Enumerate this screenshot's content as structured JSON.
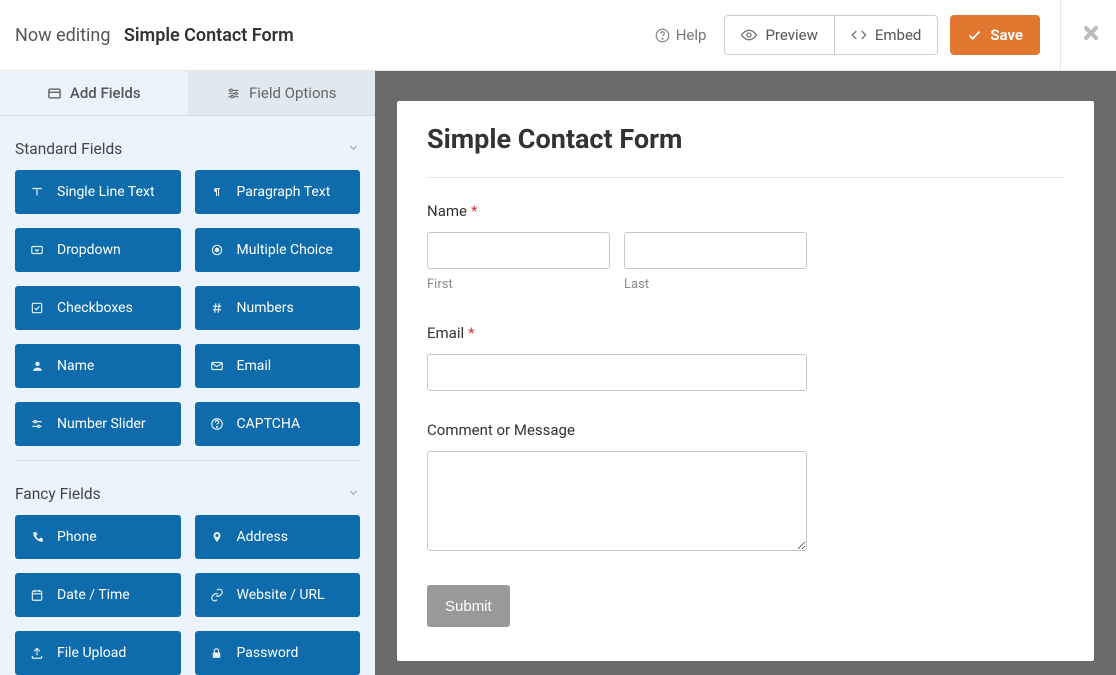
{
  "header": {
    "now_editing": "Now editing",
    "form_name": "Simple Contact Form",
    "help": "Help",
    "preview": "Preview",
    "embed": "Embed",
    "save": "Save"
  },
  "sidebar": {
    "tab_add_fields": "Add Fields",
    "tab_field_options": "Field Options",
    "section_standard": "Standard Fields",
    "section_fancy": "Fancy Fields",
    "standard_fields": {
      "single_line_text": "Single Line Text",
      "paragraph_text": "Paragraph Text",
      "dropdown": "Dropdown",
      "multiple_choice": "Multiple Choice",
      "checkboxes": "Checkboxes",
      "numbers": "Numbers",
      "name": "Name",
      "email": "Email",
      "number_slider": "Number Slider",
      "captcha": "CAPTCHA"
    },
    "fancy_fields": {
      "phone": "Phone",
      "address": "Address",
      "date_time": "Date / Time",
      "website_url": "Website / URL",
      "file_upload": "File Upload",
      "password": "Password"
    }
  },
  "form": {
    "title": "Simple Contact Form",
    "name_label": "Name",
    "first": "First",
    "last": "Last",
    "email_label": "Email",
    "comment_label": "Comment or Message",
    "submit": "Submit",
    "required_mark": "*"
  }
}
